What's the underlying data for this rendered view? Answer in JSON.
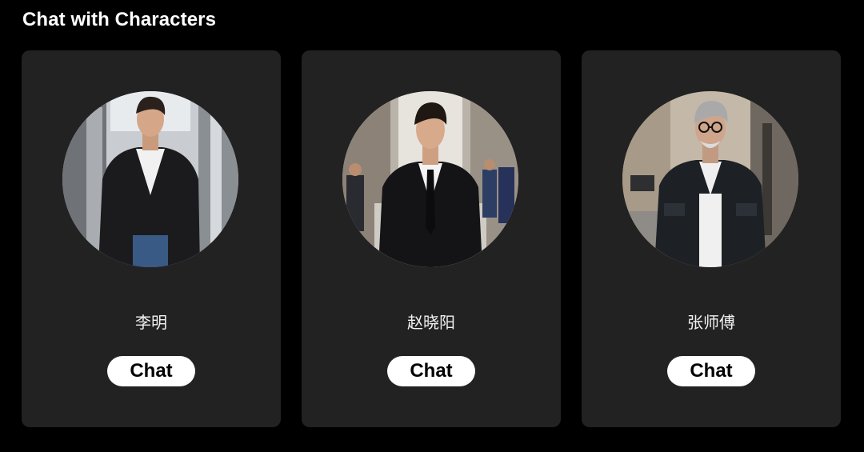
{
  "header": {
    "title": "Chat with Characters"
  },
  "characters": [
    {
      "name": "李明",
      "button_label": "Chat",
      "portrait": "young-man-leather-jacket-avatar"
    },
    {
      "name": "赵晓阳",
      "button_label": "Chat",
      "portrait": "man-black-suit-avatar"
    },
    {
      "name": "张师傅",
      "button_label": "Chat",
      "portrait": "older-man-glasses-jacket-avatar"
    }
  ],
  "colors": {
    "background": "#000000",
    "card": "#222222",
    "button": "#ffffff",
    "button_text": "#000000",
    "text": "#ffffff"
  }
}
